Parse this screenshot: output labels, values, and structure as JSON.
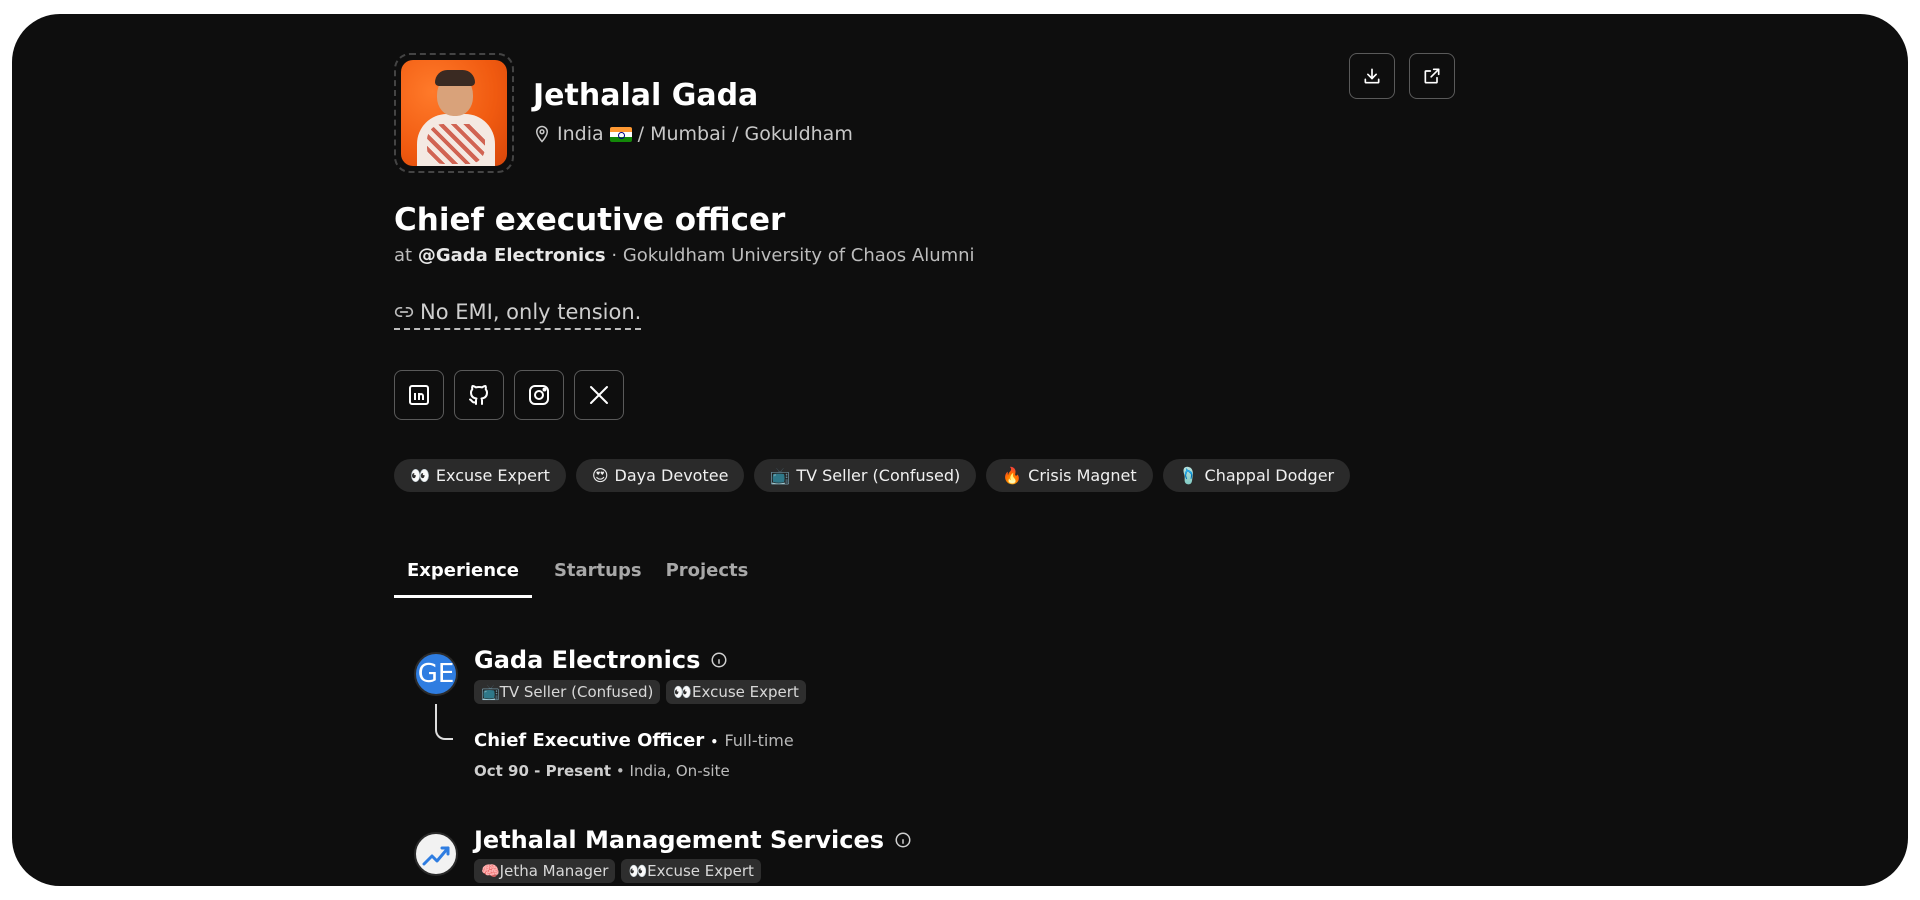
{
  "profile": {
    "name": "Jethalal Gada",
    "location": {
      "country": "India",
      "path": "/ Mumbai / Gokuldham"
    },
    "role": "Chief executive officer",
    "company_prefix": "at",
    "company": "@Gada Electronics",
    "separator": "·",
    "education": "Gokuldham University of Chaos Alumni",
    "tagline": "No EMI, only tension."
  },
  "actions": {
    "download_icon": "download-icon",
    "external_icon": "external-link-icon"
  },
  "social": [
    {
      "name": "linkedin",
      "icon": "linkedin-icon"
    },
    {
      "name": "github",
      "icon": "github-icon"
    },
    {
      "name": "instagram",
      "icon": "instagram-icon"
    },
    {
      "name": "x",
      "icon": "x-icon"
    }
  ],
  "tags": [
    {
      "emoji": "👀",
      "label": "Excuse Expert"
    },
    {
      "emoji": "😍",
      "label": "Daya Devotee"
    },
    {
      "emoji": "📺",
      "label": "TV Seller (Confused)"
    },
    {
      "emoji": "🔥",
      "label": "Crisis Magnet"
    },
    {
      "emoji": "🩴",
      "label": "Chappal Dodger"
    }
  ],
  "tabs": [
    {
      "label": "Experience",
      "active": true
    },
    {
      "label": "Startups",
      "active": false
    },
    {
      "label": "Projects",
      "active": false
    }
  ],
  "experience": [
    {
      "logo_text": "GE",
      "company": "Gada Electronics",
      "tags": [
        "📺TV Seller (Confused)",
        "👀Excuse Expert"
      ],
      "position": "Chief Executive Officer",
      "dot": "•",
      "employment_type": "Full-time",
      "dates": "Oct 90 - Present",
      "location": "India, On-site"
    },
    {
      "logo_icon": "chart-up-icon",
      "company": "Jethalal Management Services",
      "tags": [
        "🧠Jetha Manager",
        "👀Excuse Expert"
      ]
    }
  ],
  "colors": {
    "background": "#0e0e0e",
    "tag_bg": "#2a2a2a",
    "ge_logo": "#2f7de1"
  }
}
